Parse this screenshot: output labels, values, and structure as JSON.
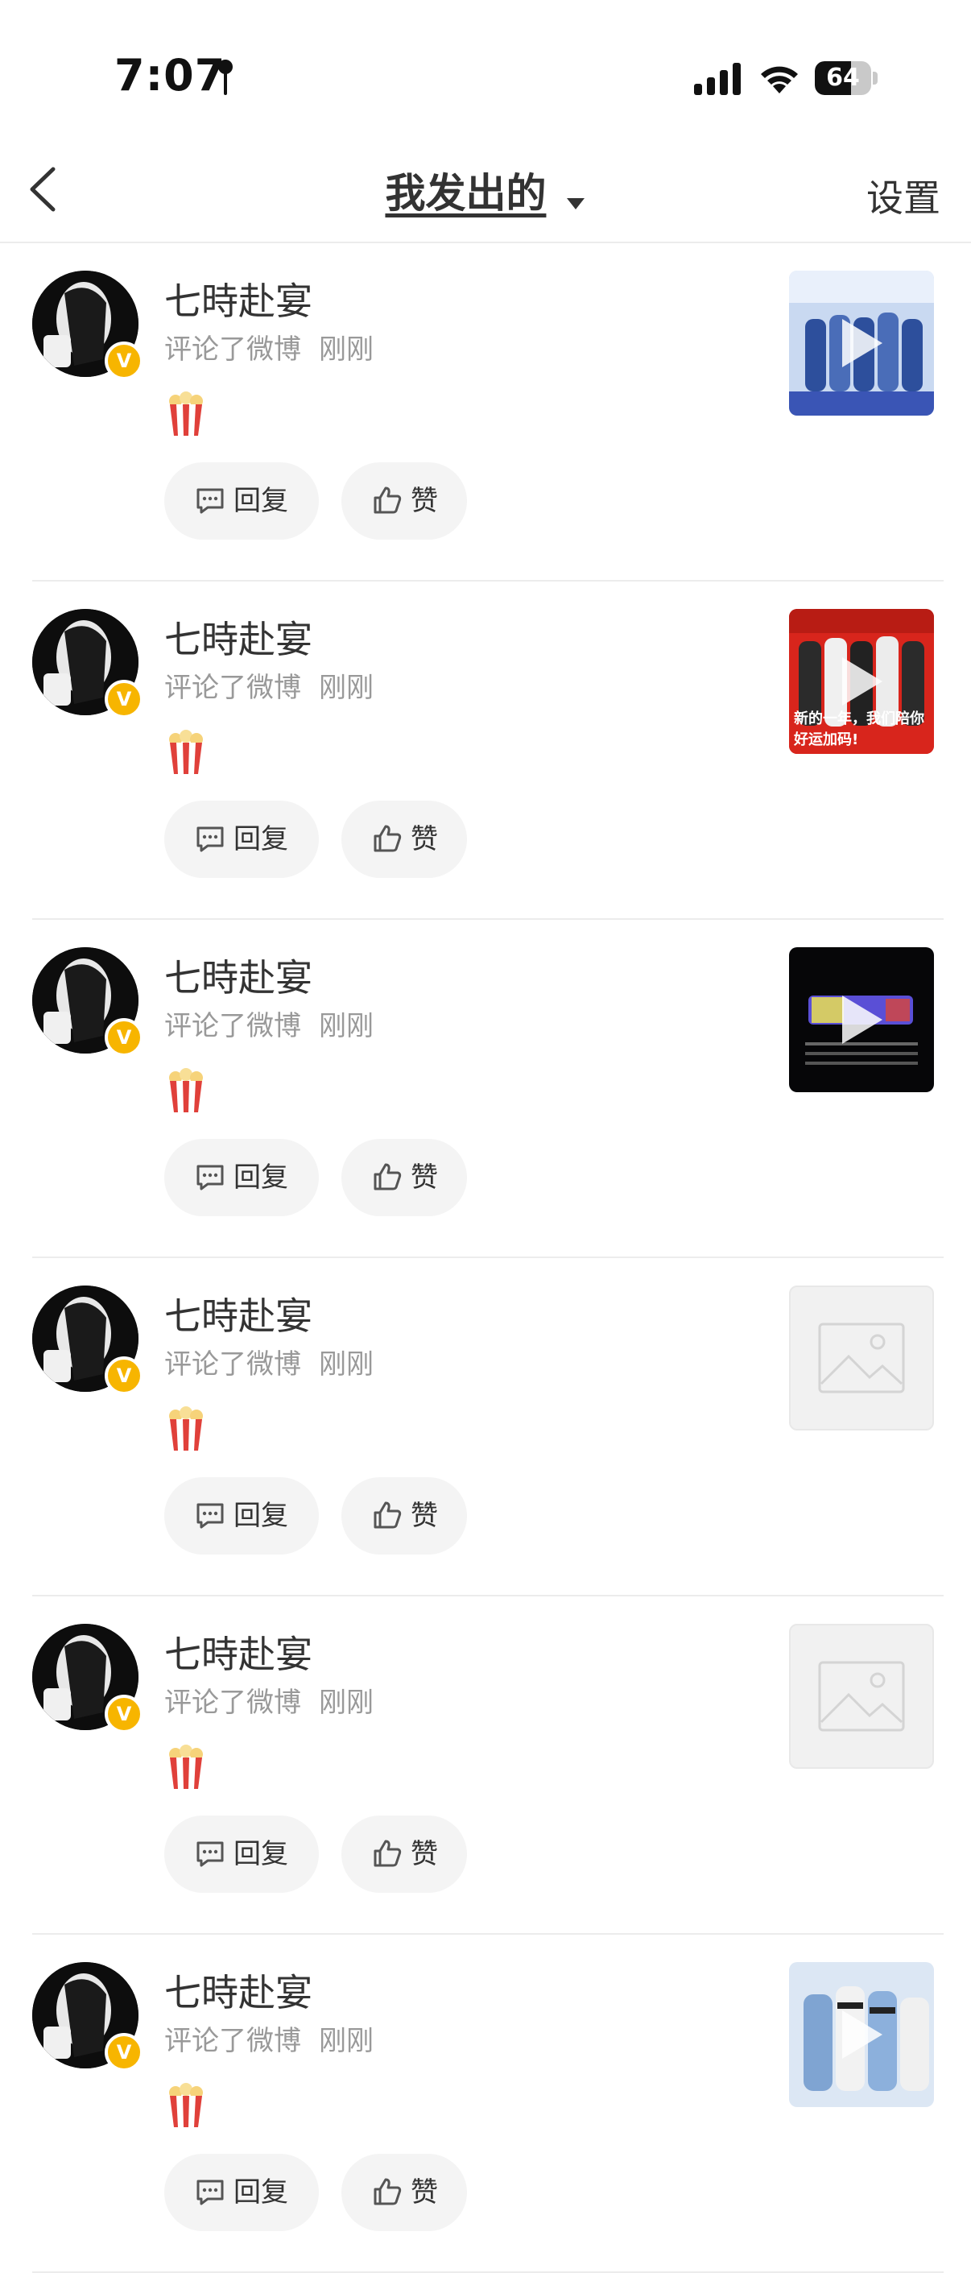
{
  "status_bar": {
    "time": "7:07",
    "battery": "64",
    "battery_level": 0.64
  },
  "nav": {
    "title": "我发出的",
    "settings": "设置"
  },
  "cards": [
    {
      "name": "七時赴宴",
      "action": "评论了微博",
      "time": "刚刚",
      "reply": "回复",
      "like": "赞",
      "thumb": "video-blue",
      "badge": "V"
    },
    {
      "name": "七時赴宴",
      "action": "评论了微博",
      "time": "刚刚",
      "reply": "回复",
      "like": "赞",
      "thumb": "video-red",
      "badge": "V",
      "thumb_caption": "新的一年，我们陪你好运加码!"
    },
    {
      "name": "七時赴宴",
      "action": "评论了微博",
      "time": "刚刚",
      "reply": "回复",
      "like": "赞",
      "thumb": "video-dark",
      "badge": "V"
    },
    {
      "name": "七時赴宴",
      "action": "评论了微博",
      "time": "刚刚",
      "reply": "回复",
      "like": "赞",
      "thumb": "placeholder",
      "badge": "V"
    },
    {
      "name": "七時赴宴",
      "action": "评论了微博",
      "time": "刚刚",
      "reply": "回复",
      "like": "赞",
      "thumb": "placeholder",
      "badge": "V"
    },
    {
      "name": "七時赴宴",
      "action": "评论了微博",
      "time": "刚刚",
      "reply": "回复",
      "like": "赞",
      "thumb": "video-light",
      "badge": "V"
    }
  ],
  "colors": {
    "accent_badge": "#f7b500",
    "button_bg": "#f4f4f4",
    "meta_text": "#999999"
  },
  "icons": [
    "location-icon",
    "signal-icon",
    "wifi-icon",
    "back-icon",
    "dropdown-icon",
    "comment-icon",
    "thumbs-up-icon",
    "popcorn-icon",
    "play-icon",
    "image-placeholder-icon"
  ]
}
